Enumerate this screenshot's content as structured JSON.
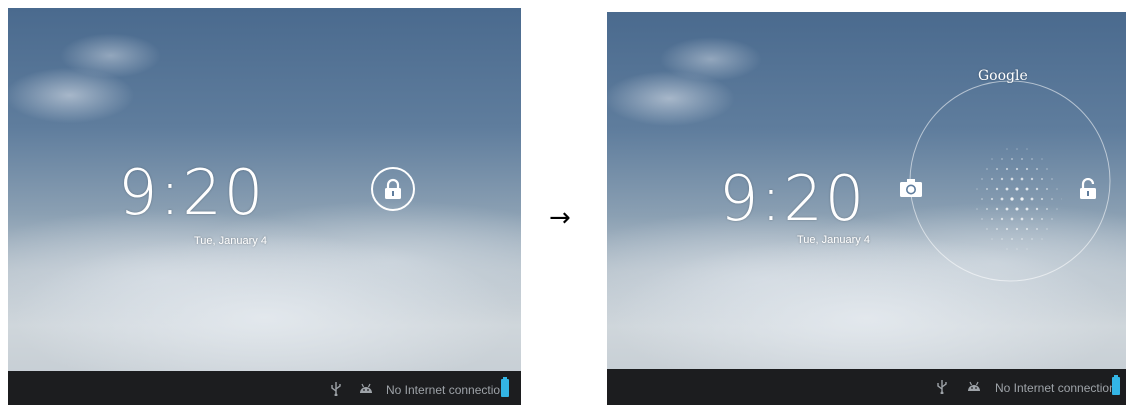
{
  "before": {
    "clock": "9:20",
    "date": "Tue, January 4",
    "status_bar": {
      "connection_text": "No Internet connection"
    }
  },
  "transition_arrow": "→",
  "after": {
    "clock": "9:20",
    "date": "Tue, January 4",
    "google_label": "Google",
    "status_bar": {
      "connection_text": "No Internet connection"
    }
  },
  "icons": {
    "lock": "lock-icon",
    "camera": "camera-icon",
    "unlock": "unlock-icon",
    "usb": "usb-icon",
    "android": "android-icon",
    "battery": "battery-icon"
  },
  "colors": {
    "status_bar_bg": "#1c1d1f",
    "status_text": "#9ea3a8",
    "battery": "#33b5e5",
    "foreground": "#ffffff"
  }
}
